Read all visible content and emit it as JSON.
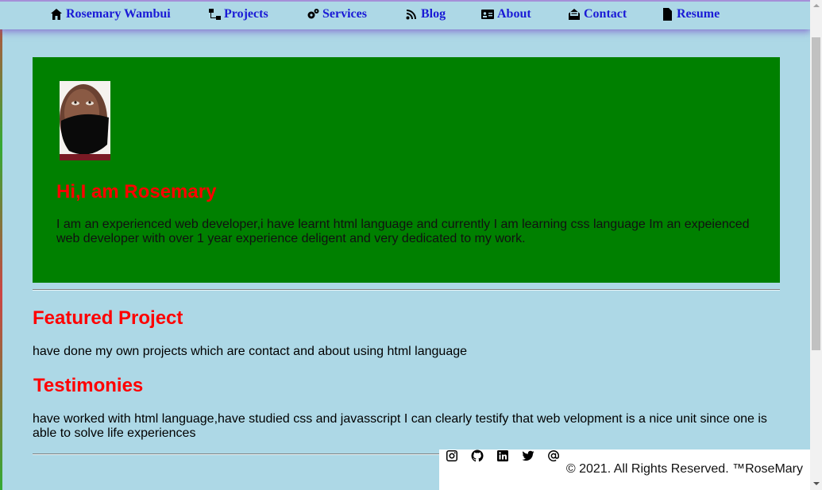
{
  "nav": {
    "items": [
      {
        "label": "Rosemary Wambui",
        "icon": "home-icon"
      },
      {
        "label": "Projects",
        "icon": "sitemap-icon"
      },
      {
        "label": "Services",
        "icon": "gears-icon"
      },
      {
        "label": "Blog",
        "icon": "blog-icon"
      },
      {
        "label": "About",
        "icon": "id-card-icon"
      },
      {
        "label": "Contact",
        "icon": "envelope-open-icon"
      },
      {
        "label": "Resume",
        "icon": "file-icon"
      }
    ]
  },
  "hero": {
    "title": "Hi,I am Rosemary",
    "text": "I am an experienced web developer,i have learnt html language and currently I am learning css language Im an expeienced web developer with over 1 year experience deligent and very dedicated to my work.",
    "bg_color": "#008000",
    "title_color": "#ff0000"
  },
  "featured": {
    "heading": "Featured Project",
    "text": "have done my own projects which are contact and about using html language"
  },
  "testimonies": {
    "heading": "Testimonies",
    "text": "have worked with html language,have studied css and javasscript I can clearly testify that web velopment is a nice unit since one is able to solve life experiences"
  },
  "footer": {
    "social": [
      "instagram-icon",
      "github-icon",
      "linkedin-icon",
      "twitter-icon",
      "at-icon"
    ],
    "copyright": "© 2021. All Rights Reserved. ™RoseMary"
  },
  "colors": {
    "page_bg": "#add8e6",
    "nav_link": "#1a1ad6",
    "heading": "#ff0000"
  }
}
